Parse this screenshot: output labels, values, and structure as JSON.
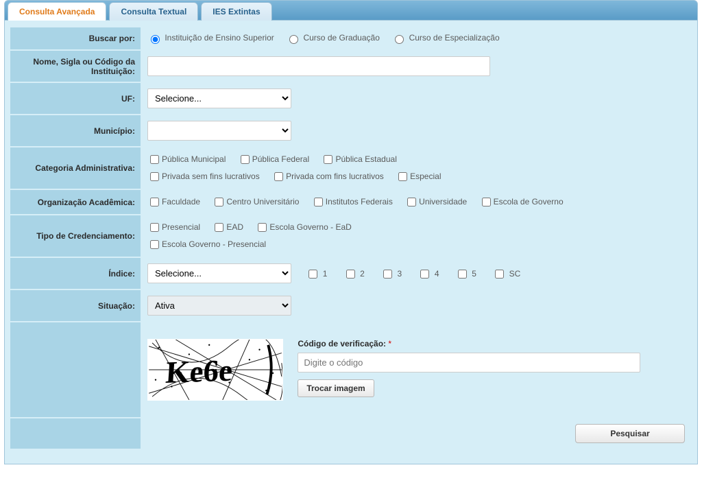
{
  "tabs": {
    "advanced": "Consulta Avançada",
    "textual": "Consulta Textual",
    "extinct": "IES Extintas"
  },
  "labels": {
    "buscar_por": "Buscar por:",
    "nome": "Nome, Sigla ou Código da Instituição:",
    "uf": "UF:",
    "municipio": "Município:",
    "categoria": "Categoria Administrativa:",
    "organizacao": "Organização Acadêmica:",
    "tipo_cred": "Tipo de Credenciamento:",
    "indice": "Índice:",
    "situacao": "Situação:"
  },
  "buscar_por_options": {
    "ies": "Instituição de Ensino Superior",
    "grad": "Curso de Graduação",
    "espec": "Curso de Especialização"
  },
  "uf": {
    "placeholder": "Selecione..."
  },
  "municipio": {
    "placeholder": ""
  },
  "categoria": {
    "pub_mun": "Pública Municipal",
    "pub_fed": "Pública Federal",
    "pub_est": "Pública Estadual",
    "priv_sfl": "Privada sem fins lucrativos",
    "priv_cfl": "Privada com fins lucrativos",
    "especial": "Especial"
  },
  "organizacao": {
    "fac": "Faculdade",
    "cu": "Centro Universitário",
    "if": "Institutos Federais",
    "uni": "Universidade",
    "egov": "Escola de Governo"
  },
  "tipo_cred": {
    "pres": "Presencial",
    "ead": "EAD",
    "egov_ead": "Escola Governo - EaD",
    "egov_pres": "Escola Governo - Presencial"
  },
  "indice": {
    "placeholder": "Selecione...",
    "g1": "1",
    "g2": "2",
    "g3": "3",
    "g4": "4",
    "g5": "5",
    "gsc": "SC"
  },
  "situacao": {
    "value": "Ativa"
  },
  "captcha": {
    "text": "Ke6e",
    "verif_label": "Código de verificação:",
    "star": "*",
    "placeholder": "Digite o código",
    "swap": "Trocar imagem"
  },
  "search_btn": "Pesquisar"
}
